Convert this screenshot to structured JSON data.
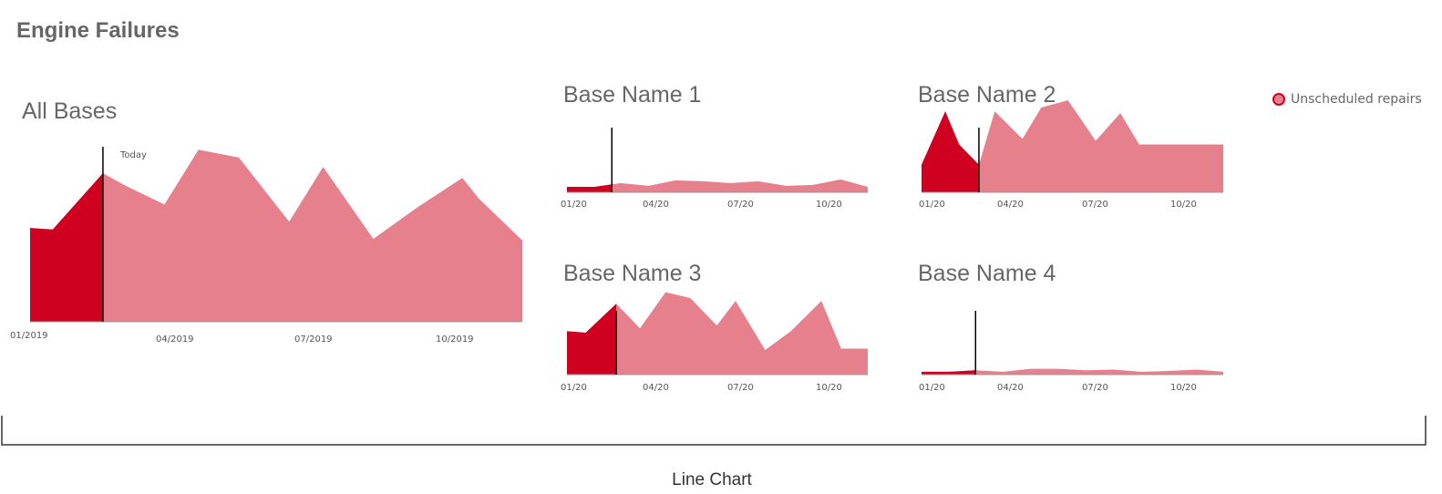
{
  "page_title": "Engine Failures",
  "caption": "Line Chart",
  "legend": {
    "label": "Unscheduled repairs",
    "color": "#e6808c",
    "border_color": "#cf0020"
  },
  "colors": {
    "past": "#cf0020",
    "future": "#e6808c",
    "axis": "#999999",
    "today_line": "#000000"
  },
  "chart_data": [
    {
      "type": "area",
      "title": "All Bases",
      "today_label": "Today",
      "x": [
        "2019-01-01",
        "2019-01-15",
        "2019-02-15",
        "2019-03-01",
        "2019-03-25",
        "2019-04-15",
        "2019-05-10",
        "2019-06-10",
        "2019-07-01",
        "2019-08-01",
        "2019-08-28",
        "2019-09-25",
        "2019-10-05",
        "2019-11-01"
      ],
      "values": [
        60,
        59,
        95,
        87,
        75,
        110,
        105,
        64,
        99,
        53,
        73,
        92,
        79,
        52
      ],
      "x_ticks": [
        "01/2019",
        "04/2019",
        "07/2019",
        "10/2019"
      ],
      "today": "2019-02-15",
      "ylim": [
        0,
        130
      ]
    },
    {
      "type": "area",
      "title": "Base Name 1",
      "x": [
        "2020-01-01",
        "2020-02-01",
        "2020-03-01",
        "2020-04-01",
        "2020-05-01",
        "2020-06-01",
        "2020-07-01",
        "2020-08-01",
        "2020-09-01",
        "2020-10-01",
        "2020-11-01",
        "2020-12-01"
      ],
      "values": [
        3,
        3,
        5,
        3.5,
        6.5,
        6,
        5,
        6,
        3.5,
        4,
        7,
        3
      ],
      "x_ticks": [
        "01/20",
        "04/20",
        "07/20",
        "10/20"
      ],
      "today": "2020-02-20",
      "ylim": [
        0,
        50
      ]
    },
    {
      "type": "area",
      "title": "Base Name 2",
      "x": [
        "2020-01-01",
        "2020-01-25",
        "2020-02-08",
        "2020-02-28",
        "2020-03-15",
        "2020-04-12",
        "2020-05-01",
        "2020-05-28",
        "2020-06-25",
        "2020-07-20",
        "2020-08-08",
        "2020-09-08",
        "2020-09-30",
        "2020-10-15",
        "2020-11-01"
      ],
      "values": [
        15,
        44,
        26,
        15,
        44,
        29,
        46,
        50,
        28,
        43,
        26,
        26,
        26,
        26,
        26
      ],
      "x_ticks": [
        "01/20",
        "04/20",
        "07/20",
        "10/20"
      ],
      "today": "2020-02-28",
      "ylim": [
        0,
        50
      ]
    },
    {
      "type": "area",
      "title": "Base Name 3",
      "x": [
        "2020-01-01",
        "2020-01-20",
        "2020-02-20",
        "2020-03-15",
        "2020-04-10",
        "2020-05-05",
        "2020-06-01",
        "2020-06-20",
        "2020-07-20",
        "2020-08-15",
        "2020-09-15",
        "2020-10-05",
        "2020-11-01"
      ],
      "values": [
        30,
        29,
        49,
        32,
        57,
        53,
        34,
        51,
        17,
        30,
        51,
        18,
        18
      ],
      "x_ticks": [
        "01/20",
        "04/20",
        "07/20",
        "10/20"
      ],
      "today": "2020-02-20",
      "ylim": [
        0,
        70
      ]
    },
    {
      "type": "area",
      "title": "Base Name 4",
      "x": [
        "2020-01-01",
        "2020-02-01",
        "2020-03-01",
        "2020-04-01",
        "2020-05-01",
        "2020-06-01",
        "2020-07-01",
        "2020-08-01",
        "2020-09-01",
        "2020-10-01",
        "2020-11-01",
        "2020-12-01"
      ],
      "values": [
        2,
        2,
        3,
        2,
        4,
        4,
        3,
        3.5,
        2,
        2.5,
        3.5,
        2
      ],
      "x_ticks": [
        "01/20",
        "04/20",
        "07/20",
        "10/20"
      ],
      "today": "2020-03-01",
      "ylim": [
        0,
        70
      ]
    }
  ]
}
